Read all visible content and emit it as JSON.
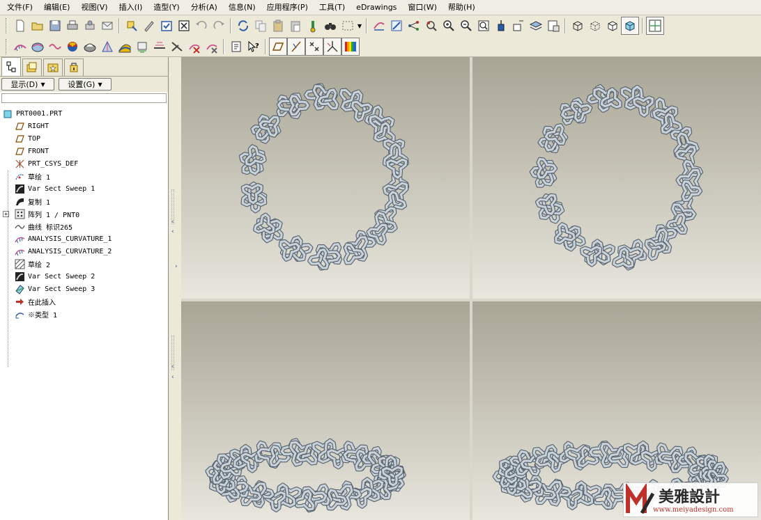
{
  "menu": [
    "文件(F)",
    "编辑(E)",
    "视图(V)",
    "插入(I)",
    "造型(Y)",
    "分析(A)",
    "信息(N)",
    "应用程序(P)",
    "工具(T)",
    "eDrawings",
    "窗口(W)",
    "帮助(H)"
  ],
  "toolbar1_icons": [
    "new-file-icon",
    "open-folder-icon",
    "save-icon",
    "print-icon",
    "model-print-icon",
    "email-icon",
    "regenerate-icon",
    "edit-definition-icon",
    "select-checkbox-icon",
    "close-window-icon",
    "undo-icon",
    "redo-icon",
    "repaint-icon",
    "copy-icon",
    "paste-icon",
    "paste-special-icon",
    "model-player-icon",
    "binoculars-icon",
    "box-select-icon",
    "datum-display-icon",
    "spin-center-icon",
    "orient-icon",
    "view-manager-icon",
    "zoom-in-icon",
    "zoom-out-icon",
    "refit-icon",
    "named-view-icon",
    "annotation-icon",
    "layers-icon",
    "view-list-icon",
    "wireframe-icon",
    "hidden-line-icon",
    "no-hidden-icon",
    "shading-icon",
    "grid-icon"
  ],
  "toolbar2_icons": [
    "curvature-icon",
    "shaded-curvature-icon",
    "section-curvature-icon",
    "color-map-icon",
    "draft-icon",
    "deviation-icon",
    "slope-icon",
    "reflection-icon",
    "highlight-lines-icon",
    "dihedral-icon",
    "delete-analysis-icon",
    "hide-analysis-icon",
    "model-info-icon",
    "help-pointer-icon",
    "datum-planes-icon",
    "datum-axes-icon",
    "datum-points-icon",
    "coordinate-systems-icon",
    "color-spectrum-icon"
  ],
  "panel": {
    "display_label": "显示(D)",
    "settings_label": "设置(G)"
  },
  "tree": {
    "root": "PRT0001.PRT",
    "items": [
      {
        "label": "RIGHT",
        "icon": "datum-plane-icon"
      },
      {
        "label": "TOP",
        "icon": "datum-plane-icon"
      },
      {
        "label": "FRONT",
        "icon": "datum-plane-icon"
      },
      {
        "label": "PRT_CSYS_DEF",
        "icon": "coordinate-system-icon"
      },
      {
        "label": "草绘 1",
        "icon": "sketch-icon"
      },
      {
        "label": "Var Sect Sweep 1",
        "icon": "sweep-icon"
      },
      {
        "label": "复制 1",
        "icon": "copy-feature-icon"
      },
      {
        "label": "阵列 1 / PNT0",
        "icon": "pattern-icon"
      },
      {
        "label": "曲线 标识265",
        "icon": "curve-icon"
      },
      {
        "label": "ANALYSIS_CURVATURE_1",
        "icon": "analysis-icon"
      },
      {
        "label": "ANALYSIS_CURVATURE_2",
        "icon": "analysis-icon"
      },
      {
        "label": "草绘 2",
        "icon": "sketch-hatched-icon"
      },
      {
        "label": "Var Sect Sweep 2",
        "icon": "sweep-icon"
      },
      {
        "label": "Var Sect Sweep 3",
        "icon": "sweep-surface-icon"
      },
      {
        "label": "在此插入",
        "icon": "insert-here-arrow-icon"
      },
      {
        "label": "※类型 1",
        "icon": "style-icon"
      }
    ]
  },
  "viewports": [
    "top-left",
    "top-right",
    "bottom-left",
    "bottom-right"
  ],
  "watermark": {
    "brand": "美雅設計",
    "url": "www.meiyadesign.com"
  },
  "colors": {
    "model": "#c9d2d9",
    "model_shadow": "#56616b",
    "viewport_top": "#a8a595",
    "viewport_bottom": "#e8e6dd",
    "logo_red": "#c0302a"
  }
}
